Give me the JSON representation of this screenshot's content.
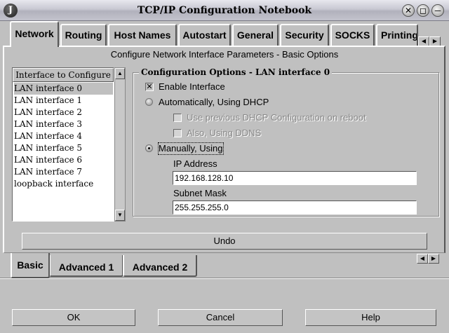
{
  "window": {
    "title": "TCP/IP Configuration Notebook",
    "app_icon_glyph": "J"
  },
  "tabs": [
    {
      "label": "Network"
    },
    {
      "label": "Routing"
    },
    {
      "label": "Host Names"
    },
    {
      "label": "Autostart"
    },
    {
      "label": "General"
    },
    {
      "label": "Security"
    },
    {
      "label": "SOCKS"
    },
    {
      "label": "Printing"
    }
  ],
  "page_caption": "Configure Network Interface Parameters - Basic Options",
  "interface_list": {
    "header": "Interface to Configure",
    "items": [
      "LAN interface 0",
      "LAN interface 1",
      "LAN interface 2",
      "LAN interface 3",
      "LAN interface 4",
      "LAN interface 5",
      "LAN interface 6",
      "LAN interface 7",
      "loopback interface"
    ],
    "selected_index": 0
  },
  "options": {
    "group_title": "Configuration Options - LAN interface 0",
    "enable_interface": {
      "label": "Enable Interface",
      "checked": true
    },
    "dhcp_radio": {
      "label": "Automatically, Using DHCP",
      "checked": false
    },
    "prev_dhcp": {
      "label": "Use previous DHCP Configuration on reboot",
      "checked": false
    },
    "ddns": {
      "label": "Also, Using DDNS",
      "checked": false
    },
    "manual_radio": {
      "label": "Manually, Using",
      "checked": true
    },
    "ip_label": "IP Address",
    "ip_value": "192.168.128.10",
    "mask_label": "Subnet Mask",
    "mask_value": "255.255.255.0"
  },
  "undo_label": "Undo",
  "bottom_tabs": [
    {
      "label": "Basic"
    },
    {
      "label": "Advanced 1"
    },
    {
      "label": "Advanced 2"
    }
  ],
  "buttons": {
    "ok": "OK",
    "cancel": "Cancel",
    "help": "Help"
  },
  "glyphs": {
    "check": "✕",
    "close": "✕",
    "maximize": "◻",
    "minimize": "─",
    "left": "◀",
    "right": "▶",
    "up": "▲",
    "down": "▼"
  }
}
